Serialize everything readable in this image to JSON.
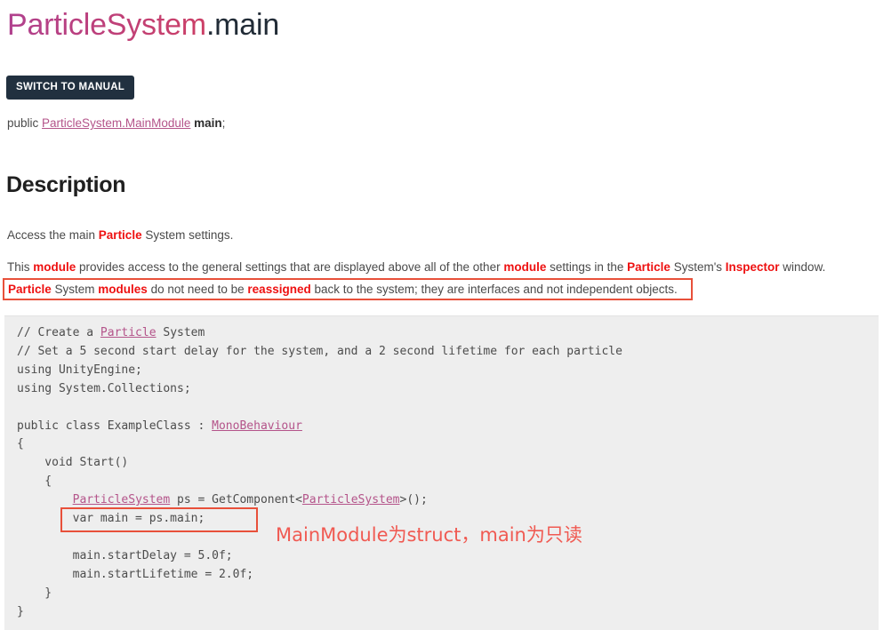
{
  "title": {
    "class_part": "ParticleSystem",
    "member_part": ".main",
    "full": "ParticleSystem.main"
  },
  "buttons": {
    "switch_to_manual": "SWITCH TO MANUAL"
  },
  "signature": {
    "modifier": "public",
    "type_link": "ParticleSystem.MainModule",
    "member": "main",
    "terminator": ";"
  },
  "description": {
    "heading": "Description",
    "paragraph1": {
      "part1": "Access the main ",
      "kw1": "Particle",
      "part2": " System settings."
    },
    "paragraph2": {
      "part1": "This ",
      "kw1": "module",
      "part2": " provides access to the general settings that are displayed above all of the other ",
      "kw2": "module",
      "part3": " settings in the ",
      "kw3": "Particle",
      "part4": " System's ",
      "kw4": "Inspector",
      "part5": " window."
    },
    "note": {
      "kw1": "Particle",
      "part1": " System ",
      "kw2": "modules",
      "part2": " do not need to be ",
      "kw3": "reassigned",
      "part3": " back to the system; they are interfaces and not independent objects."
    }
  },
  "code": {
    "line01": "// Create a ",
    "line01_ref": "Particle",
    "line01_end": " System",
    "line02": "// Set a 5 second start delay for the system, and a 2 second lifetime for each particle",
    "line03": "using UnityEngine;",
    "line04": "using System.Collections;",
    "line05": "",
    "line06_pre": "public class ExampleClass : ",
    "line06_ref": "MonoBehaviour",
    "line07": "{",
    "line08": "    void Start()",
    "line09": "    {",
    "line10_indent": "        ",
    "line10_ref1": "ParticleSystem",
    "line10_mid": " ps = GetComponent<",
    "line10_ref2": "ParticleSystem",
    "line10_end": ">();",
    "line11": "        var main = ps.main;",
    "line12": "",
    "line13": "        main.startDelay = 5.0f;",
    "line14": "        main.startLifetime = 2.0f;",
    "line15": "    }",
    "line16": "}"
  },
  "annotations": {
    "chinese_note": "MainModule为struct，main为只读"
  },
  "colors": {
    "title_class": "#c9417a",
    "title_member": "#222c37",
    "link": "#b4548a",
    "keyword_red": "#ee1111",
    "annotation_red": "#f05a52",
    "box_border": "#e8503a",
    "button_bg": "#21303f",
    "code_bg": "#eeeeee"
  }
}
